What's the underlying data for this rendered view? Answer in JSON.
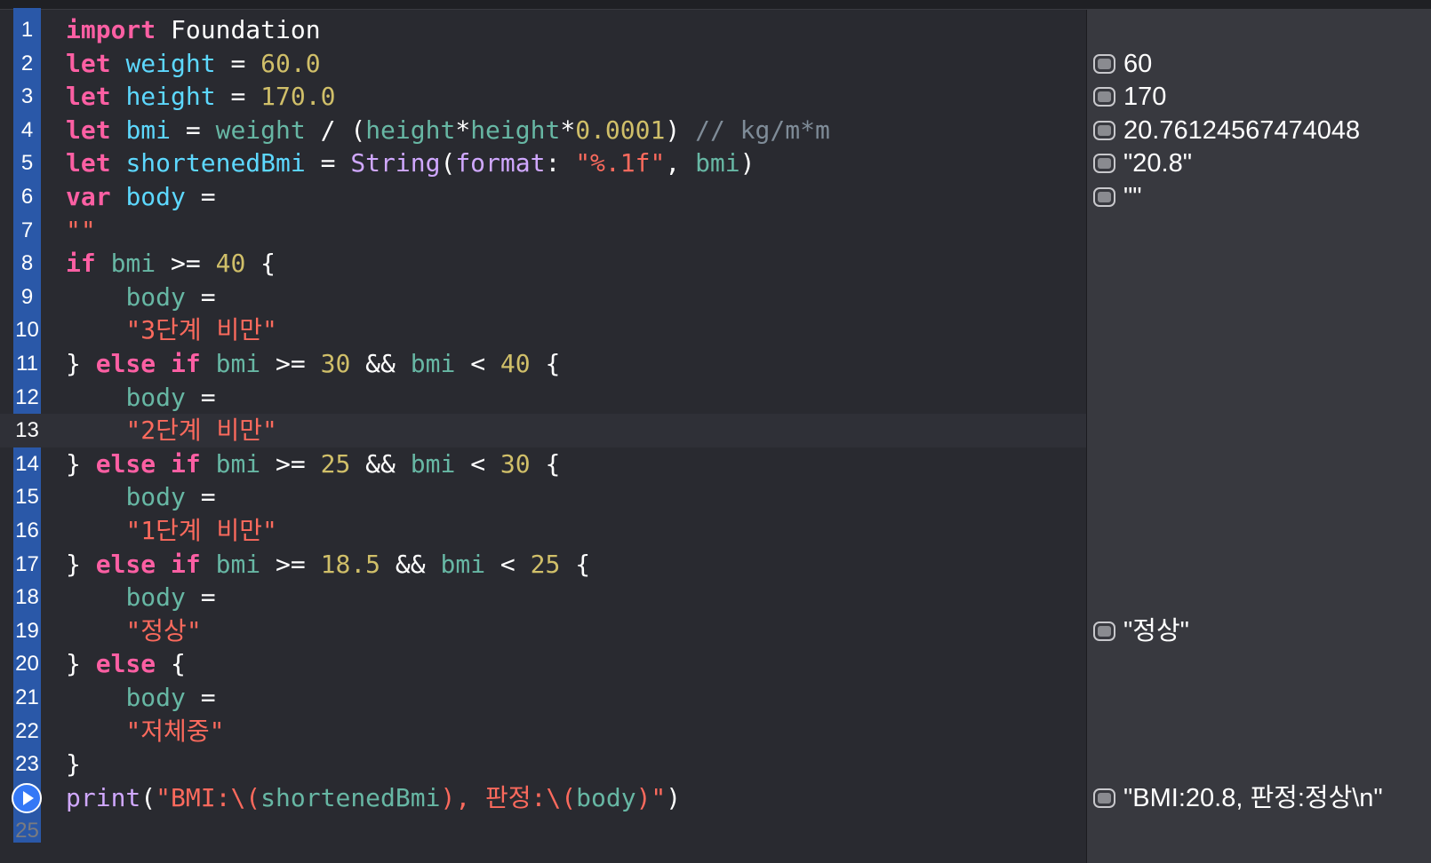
{
  "editor": {
    "line_numbers": [
      "1",
      "2",
      "3",
      "4",
      "5",
      "6",
      "7",
      "8",
      "9",
      "10",
      "11",
      "12",
      "13",
      "14",
      "15",
      "16",
      "17",
      "18",
      "19",
      "20",
      "21",
      "22",
      "23",
      "24",
      "25"
    ],
    "current_line": "13",
    "lines": [
      [
        {
          "t": "import",
          "c": "kw"
        },
        {
          "t": " Foundation",
          "c": "plain"
        }
      ],
      [
        {
          "t": "let",
          "c": "kw"
        },
        {
          "t": " ",
          "c": "plain"
        },
        {
          "t": "weight",
          "c": "decl"
        },
        {
          "t": " = ",
          "c": "plain"
        },
        {
          "t": "60.0",
          "c": "num"
        }
      ],
      [
        {
          "t": "let",
          "c": "kw"
        },
        {
          "t": " ",
          "c": "plain"
        },
        {
          "t": "height",
          "c": "decl"
        },
        {
          "t": " = ",
          "c": "plain"
        },
        {
          "t": "170.0",
          "c": "num"
        }
      ],
      [
        {
          "t": "let",
          "c": "kw"
        },
        {
          "t": " ",
          "c": "plain"
        },
        {
          "t": "bmi",
          "c": "decl"
        },
        {
          "t": " = ",
          "c": "plain"
        },
        {
          "t": "weight",
          "c": "var"
        },
        {
          "t": " / (",
          "c": "plain"
        },
        {
          "t": "height",
          "c": "var"
        },
        {
          "t": "*",
          "c": "plain"
        },
        {
          "t": "height",
          "c": "var"
        },
        {
          "t": "*",
          "c": "plain"
        },
        {
          "t": "0.0001",
          "c": "num"
        },
        {
          "t": ") ",
          "c": "plain"
        },
        {
          "t": "// kg/m*m",
          "c": "cmt"
        }
      ],
      [
        {
          "t": "let",
          "c": "kw"
        },
        {
          "t": " ",
          "c": "plain"
        },
        {
          "t": "shortenedBmi",
          "c": "decl"
        },
        {
          "t": " = ",
          "c": "plain"
        },
        {
          "t": "String",
          "c": "type"
        },
        {
          "t": "(",
          "c": "plain"
        },
        {
          "t": "format",
          "c": "type"
        },
        {
          "t": ": ",
          "c": "plain"
        },
        {
          "t": "\"%.1f\"",
          "c": "str"
        },
        {
          "t": ", ",
          "c": "plain"
        },
        {
          "t": "bmi",
          "c": "var"
        },
        {
          "t": ")",
          "c": "plain"
        }
      ],
      [
        {
          "t": "var",
          "c": "kw"
        },
        {
          "t": " ",
          "c": "plain"
        },
        {
          "t": "body",
          "c": "decl"
        },
        {
          "t": " =",
          "c": "plain"
        }
      ],
      [
        {
          "t": "\"\"",
          "c": "str"
        }
      ],
      [
        {
          "t": "if",
          "c": "kw"
        },
        {
          "t": " ",
          "c": "plain"
        },
        {
          "t": "bmi",
          "c": "var"
        },
        {
          "t": " >= ",
          "c": "plain"
        },
        {
          "t": "40",
          "c": "num"
        },
        {
          "t": " {",
          "c": "plain"
        }
      ],
      [
        {
          "t": "    ",
          "c": "plain"
        },
        {
          "t": "body",
          "c": "var"
        },
        {
          "t": " =",
          "c": "plain"
        }
      ],
      [
        {
          "t": "    ",
          "c": "plain"
        },
        {
          "t": "\"3단계 비만\"",
          "c": "str"
        }
      ],
      [
        {
          "t": "} ",
          "c": "plain"
        },
        {
          "t": "else",
          "c": "kw"
        },
        {
          "t": " ",
          "c": "plain"
        },
        {
          "t": "if",
          "c": "kw"
        },
        {
          "t": " ",
          "c": "plain"
        },
        {
          "t": "bmi",
          "c": "var"
        },
        {
          "t": " >= ",
          "c": "plain"
        },
        {
          "t": "30",
          "c": "num"
        },
        {
          "t": " && ",
          "c": "plain"
        },
        {
          "t": "bmi",
          "c": "var"
        },
        {
          "t": " < ",
          "c": "plain"
        },
        {
          "t": "40",
          "c": "num"
        },
        {
          "t": " {",
          "c": "plain"
        }
      ],
      [
        {
          "t": "    ",
          "c": "plain"
        },
        {
          "t": "body",
          "c": "var"
        },
        {
          "t": " =",
          "c": "plain"
        }
      ],
      [
        {
          "t": "    ",
          "c": "plain"
        },
        {
          "t": "\"2단계 비만\"",
          "c": "str"
        }
      ],
      [
        {
          "t": "} ",
          "c": "plain"
        },
        {
          "t": "else",
          "c": "kw"
        },
        {
          "t": " ",
          "c": "plain"
        },
        {
          "t": "if",
          "c": "kw"
        },
        {
          "t": " ",
          "c": "plain"
        },
        {
          "t": "bmi",
          "c": "var"
        },
        {
          "t": " >= ",
          "c": "plain"
        },
        {
          "t": "25",
          "c": "num"
        },
        {
          "t": " && ",
          "c": "plain"
        },
        {
          "t": "bmi",
          "c": "var"
        },
        {
          "t": " < ",
          "c": "plain"
        },
        {
          "t": "30",
          "c": "num"
        },
        {
          "t": " {",
          "c": "plain"
        }
      ],
      [
        {
          "t": "    ",
          "c": "plain"
        },
        {
          "t": "body",
          "c": "var"
        },
        {
          "t": " =",
          "c": "plain"
        }
      ],
      [
        {
          "t": "    ",
          "c": "plain"
        },
        {
          "t": "\"1단계 비만\"",
          "c": "str"
        }
      ],
      [
        {
          "t": "} ",
          "c": "plain"
        },
        {
          "t": "else",
          "c": "kw"
        },
        {
          "t": " ",
          "c": "plain"
        },
        {
          "t": "if",
          "c": "kw"
        },
        {
          "t": " ",
          "c": "plain"
        },
        {
          "t": "bmi",
          "c": "var"
        },
        {
          "t": " >= ",
          "c": "plain"
        },
        {
          "t": "18.5",
          "c": "num"
        },
        {
          "t": " && ",
          "c": "plain"
        },
        {
          "t": "bmi",
          "c": "var"
        },
        {
          "t": " < ",
          "c": "plain"
        },
        {
          "t": "25",
          "c": "num"
        },
        {
          "t": " {",
          "c": "plain"
        }
      ],
      [
        {
          "t": "    ",
          "c": "plain"
        },
        {
          "t": "body",
          "c": "var"
        },
        {
          "t": " =",
          "c": "plain"
        }
      ],
      [
        {
          "t": "    ",
          "c": "plain"
        },
        {
          "t": "\"정상\"",
          "c": "str"
        }
      ],
      [
        {
          "t": "} ",
          "c": "plain"
        },
        {
          "t": "else",
          "c": "kw"
        },
        {
          "t": " {",
          "c": "plain"
        }
      ],
      [
        {
          "t": "    ",
          "c": "plain"
        },
        {
          "t": "body",
          "c": "var"
        },
        {
          "t": " =",
          "c": "plain"
        }
      ],
      [
        {
          "t": "    ",
          "c": "plain"
        },
        {
          "t": "\"저체중\"",
          "c": "str"
        }
      ],
      [
        {
          "t": "}",
          "c": "plain"
        }
      ],
      [
        {
          "t": "print",
          "c": "type"
        },
        {
          "t": "(",
          "c": "plain"
        },
        {
          "t": "\"BMI:\\(",
          "c": "str"
        },
        {
          "t": "shortenedBmi",
          "c": "var"
        },
        {
          "t": "), 판정:\\(",
          "c": "str"
        },
        {
          "t": "body",
          "c": "var"
        },
        {
          "t": ")\"",
          "c": "str"
        },
        {
          "t": ")",
          "c": "plain"
        }
      ],
      []
    ]
  },
  "results": [
    {
      "line": "2",
      "value": "60"
    },
    {
      "line": "3",
      "value": "170"
    },
    {
      "line": "4",
      "value": "20.76124567474048"
    },
    {
      "line": "5",
      "value": "\"20.8\""
    },
    {
      "line": "6",
      "value": "\"\""
    },
    {
      "line": "19",
      "value": "\"정상\""
    },
    {
      "line": "24",
      "value": "\"BMI:20.8, 판정:정상\\n\""
    }
  ],
  "run_line": "24",
  "icons": {
    "run": "play-circle-icon",
    "quicklook": "quick-look-icon"
  }
}
